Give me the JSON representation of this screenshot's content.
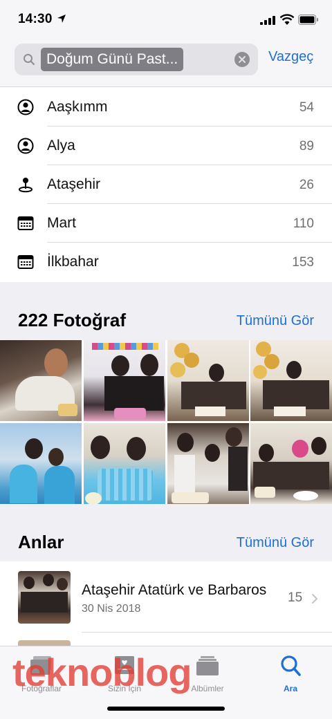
{
  "status_bar": {
    "time": "14:30"
  },
  "search": {
    "token": "Doğum Günü Past...",
    "cancel_label": "Vazgeç"
  },
  "suggestions": [
    {
      "icon": "person-circle-icon",
      "label": "Aaşkımm",
      "count": "54"
    },
    {
      "icon": "person-circle-icon",
      "label": "Alya",
      "count": "89"
    },
    {
      "icon": "location-pin-icon",
      "label": "Ataşehir",
      "count": "26"
    },
    {
      "icon": "calendar-icon",
      "label": "Mart",
      "count": "110"
    },
    {
      "icon": "calendar-icon",
      "label": "İlkbahar",
      "count": "153"
    }
  ],
  "photos_section": {
    "title": "222 Fotoğraf",
    "see_all": "Tümünü Gör"
  },
  "moments_section": {
    "title": "Anlar",
    "see_all": "Tümünü Gör"
  },
  "moment": {
    "title": "Ataşehir Atatürk ve Barbaros",
    "date": "30 Nis 2018",
    "count": "15"
  },
  "tabs": [
    {
      "label": "Fotoğraflar",
      "icon": "photos-stack-icon",
      "active": false
    },
    {
      "label": "Sizin İçin",
      "icon": "for-you-heart-icon",
      "active": false
    },
    {
      "label": "Albümler",
      "icon": "albums-icon",
      "active": false
    },
    {
      "label": "Ara",
      "icon": "search-icon",
      "active": true
    }
  ],
  "watermark": "teknoblog",
  "colors": {
    "accent": "#1d6fd6",
    "watermark": "#e23c32",
    "background_gray": "#efeff4"
  }
}
